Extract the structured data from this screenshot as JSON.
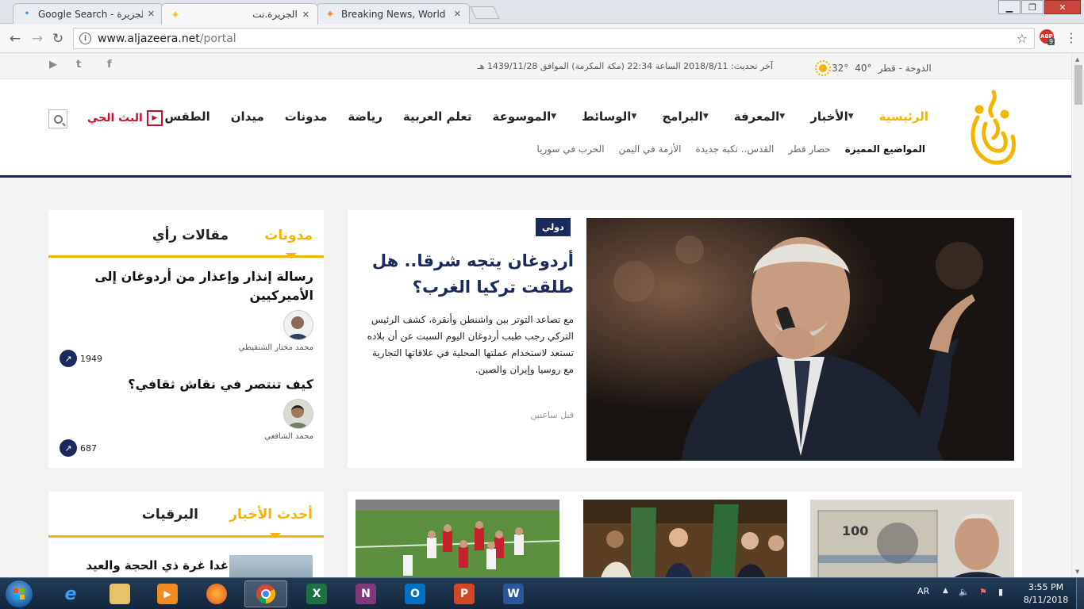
{
  "browser": {
    "tabs": [
      {
        "title": "Google Search - الجزيرة",
        "active": false
      },
      {
        "title": "الجزيرة.نت",
        "active": true
      },
      {
        "title": "Breaking News, World Ne",
        "active": false
      }
    ],
    "url_host": "www.aljazeera.net",
    "url_path": "/portal",
    "extension_label": "ABP",
    "extension_badge": "9"
  },
  "infobar": {
    "weather_city": "الدوحة - قطر",
    "temp_high": "40°",
    "temp_low": "32°",
    "updated": "آخر تحديث: 2018/8/11 الساعة 22:34 (مكة المكرمة) الموافق 1439/11/28 هـ",
    "social": [
      "f",
      "t",
      "▶"
    ]
  },
  "nav": {
    "items": [
      {
        "label": "الرئيسية",
        "caret": false,
        "home": true
      },
      {
        "label": "الأخبار",
        "caret": true
      },
      {
        "label": "المعرفة",
        "caret": true
      },
      {
        "label": "البرامج",
        "caret": true
      },
      {
        "label": "الوسائط",
        "caret": true
      },
      {
        "label": "الموسوعة",
        "caret": true
      },
      {
        "label": "تعلم العربية",
        "caret": false
      },
      {
        "label": "رياضة",
        "caret": false
      },
      {
        "label": "مدونات",
        "caret": false
      },
      {
        "label": "ميدان",
        "caret": false
      },
      {
        "label": "الطقس",
        "caret": false
      }
    ],
    "live": "البث الحي",
    "featured_heading": "المواضيع المميزة",
    "featured_topics": [
      "حصار قطر",
      "القدس.. نكبة جديدة",
      "الأزمة في اليمن",
      "الحرب في سوريا"
    ]
  },
  "featured": {
    "badge": "دولي",
    "title": "أردوغان يتجه شرقا.. هل طلقت تركيا الغرب؟",
    "excerpt": "مع تصاعد التوتر بين واشنطن وأنقرة، كشف الرئيس التركي رجب طيب أردوغان اليوم السبت عن أن بلاده تستعد لاستخدام عملتها المحلية في علاقاتها التجارية مع روسيا وإيران والصين.",
    "time": "قبل ساعتين"
  },
  "sidebox": {
    "tab_active": "مدونات",
    "tab_other": "مقالات رأي",
    "articles": [
      {
        "title": "رسالة إنذار وإعذار من أردوغان إلى الأميركيين",
        "author": "محمد مختار الشنقيطي",
        "views": "1949"
      },
      {
        "title": "كيف تنتصر في نقاش ثقافي؟",
        "author": "محمد الشافعي",
        "views": "687"
      }
    ]
  },
  "latest": {
    "tab_active": "أحدث الأخبار",
    "tab_other": "البرقيات",
    "first_item": "غدا غرة ذي الحجة والعيد"
  },
  "taskbar": {
    "lang": "AR",
    "time": "3:55 PM",
    "date": "8/11/2018"
  }
}
